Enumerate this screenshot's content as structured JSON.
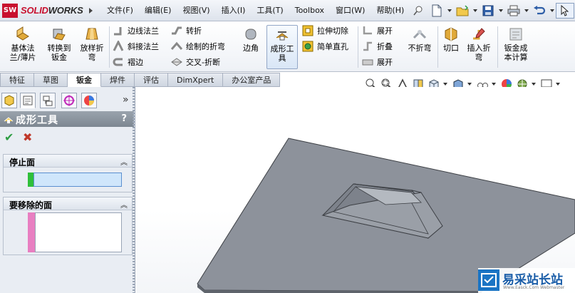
{
  "app": {
    "logo_mark": "SW",
    "logo_text_a": "SOLID",
    "logo_text_b": "WORKS"
  },
  "menu": [
    "文件(F)",
    "编辑(E)",
    "视图(V)",
    "插入(I)",
    "工具(T)",
    "Toolbox",
    "窗口(W)",
    "帮助(H)"
  ],
  "quick_access": [
    "pin-icon",
    "new-document-icon",
    "open-folder-icon",
    "save-icon",
    "print-icon",
    "undo-icon",
    "select-arrow-icon"
  ],
  "commands": {
    "base_flange": "基体法\n兰/薄片",
    "convert_to_sheet": "转换到\n钣金",
    "lofted_bend": "放样折\n弯",
    "edge_flange": "边线法兰",
    "miter_flange": "斜接法兰",
    "hem": "褶边",
    "jog": "转折",
    "sketched_bend": "绘制的折弯",
    "cross_break": "交叉-折断",
    "corners": "边角",
    "forming_tool": "成形工\n具",
    "extruded_cut": "拉伸切除",
    "simple_hole": "简单直孔",
    "unfold": "展开",
    "fold": "折叠",
    "flatten": "展开",
    "no_bends": "不折弯",
    "rip": "切口",
    "insert_bends": "插入折\n弯",
    "sheet_metal_cost": "钣金成\n本计算"
  },
  "tabs": [
    {
      "label": "特征",
      "active": false
    },
    {
      "label": "草图",
      "active": false
    },
    {
      "label": "钣金",
      "active": true
    },
    {
      "label": "焊件",
      "active": false
    },
    {
      "label": "评估",
      "active": false
    },
    {
      "label": "DimXpert",
      "active": false
    },
    {
      "label": "办公室产品",
      "active": false
    }
  ],
  "view_toolbar": [
    "zoom-to-fit-icon",
    "zoom-area-icon",
    "previous-view-icon",
    "section-view-icon",
    "view-orientation-icon",
    "display-style-icon",
    "hide-show-icon",
    "edit-appearance-icon",
    "apply-scene-icon",
    "view-settings-icon"
  ],
  "panel": {
    "collapse_symbol": "»",
    "title": "成形工具",
    "help": "?",
    "ok_symbol": "✔",
    "cancel_symbol": "✖",
    "stop_face_label": "停止面",
    "faces_to_remove_label": "要移除的面",
    "collapse_marker": "︽"
  },
  "colors": {
    "accent_blue": "#1a74c4",
    "stop_face_marker": "#2fbf3a",
    "remove_face_marker": "#e87fc1",
    "part_top": "#8d929b",
    "part_dark": "#5f646c"
  },
  "watermark": {
    "text_cn": "易采站长站",
    "text_en": "Www.Easck.Com  Webmaster"
  }
}
